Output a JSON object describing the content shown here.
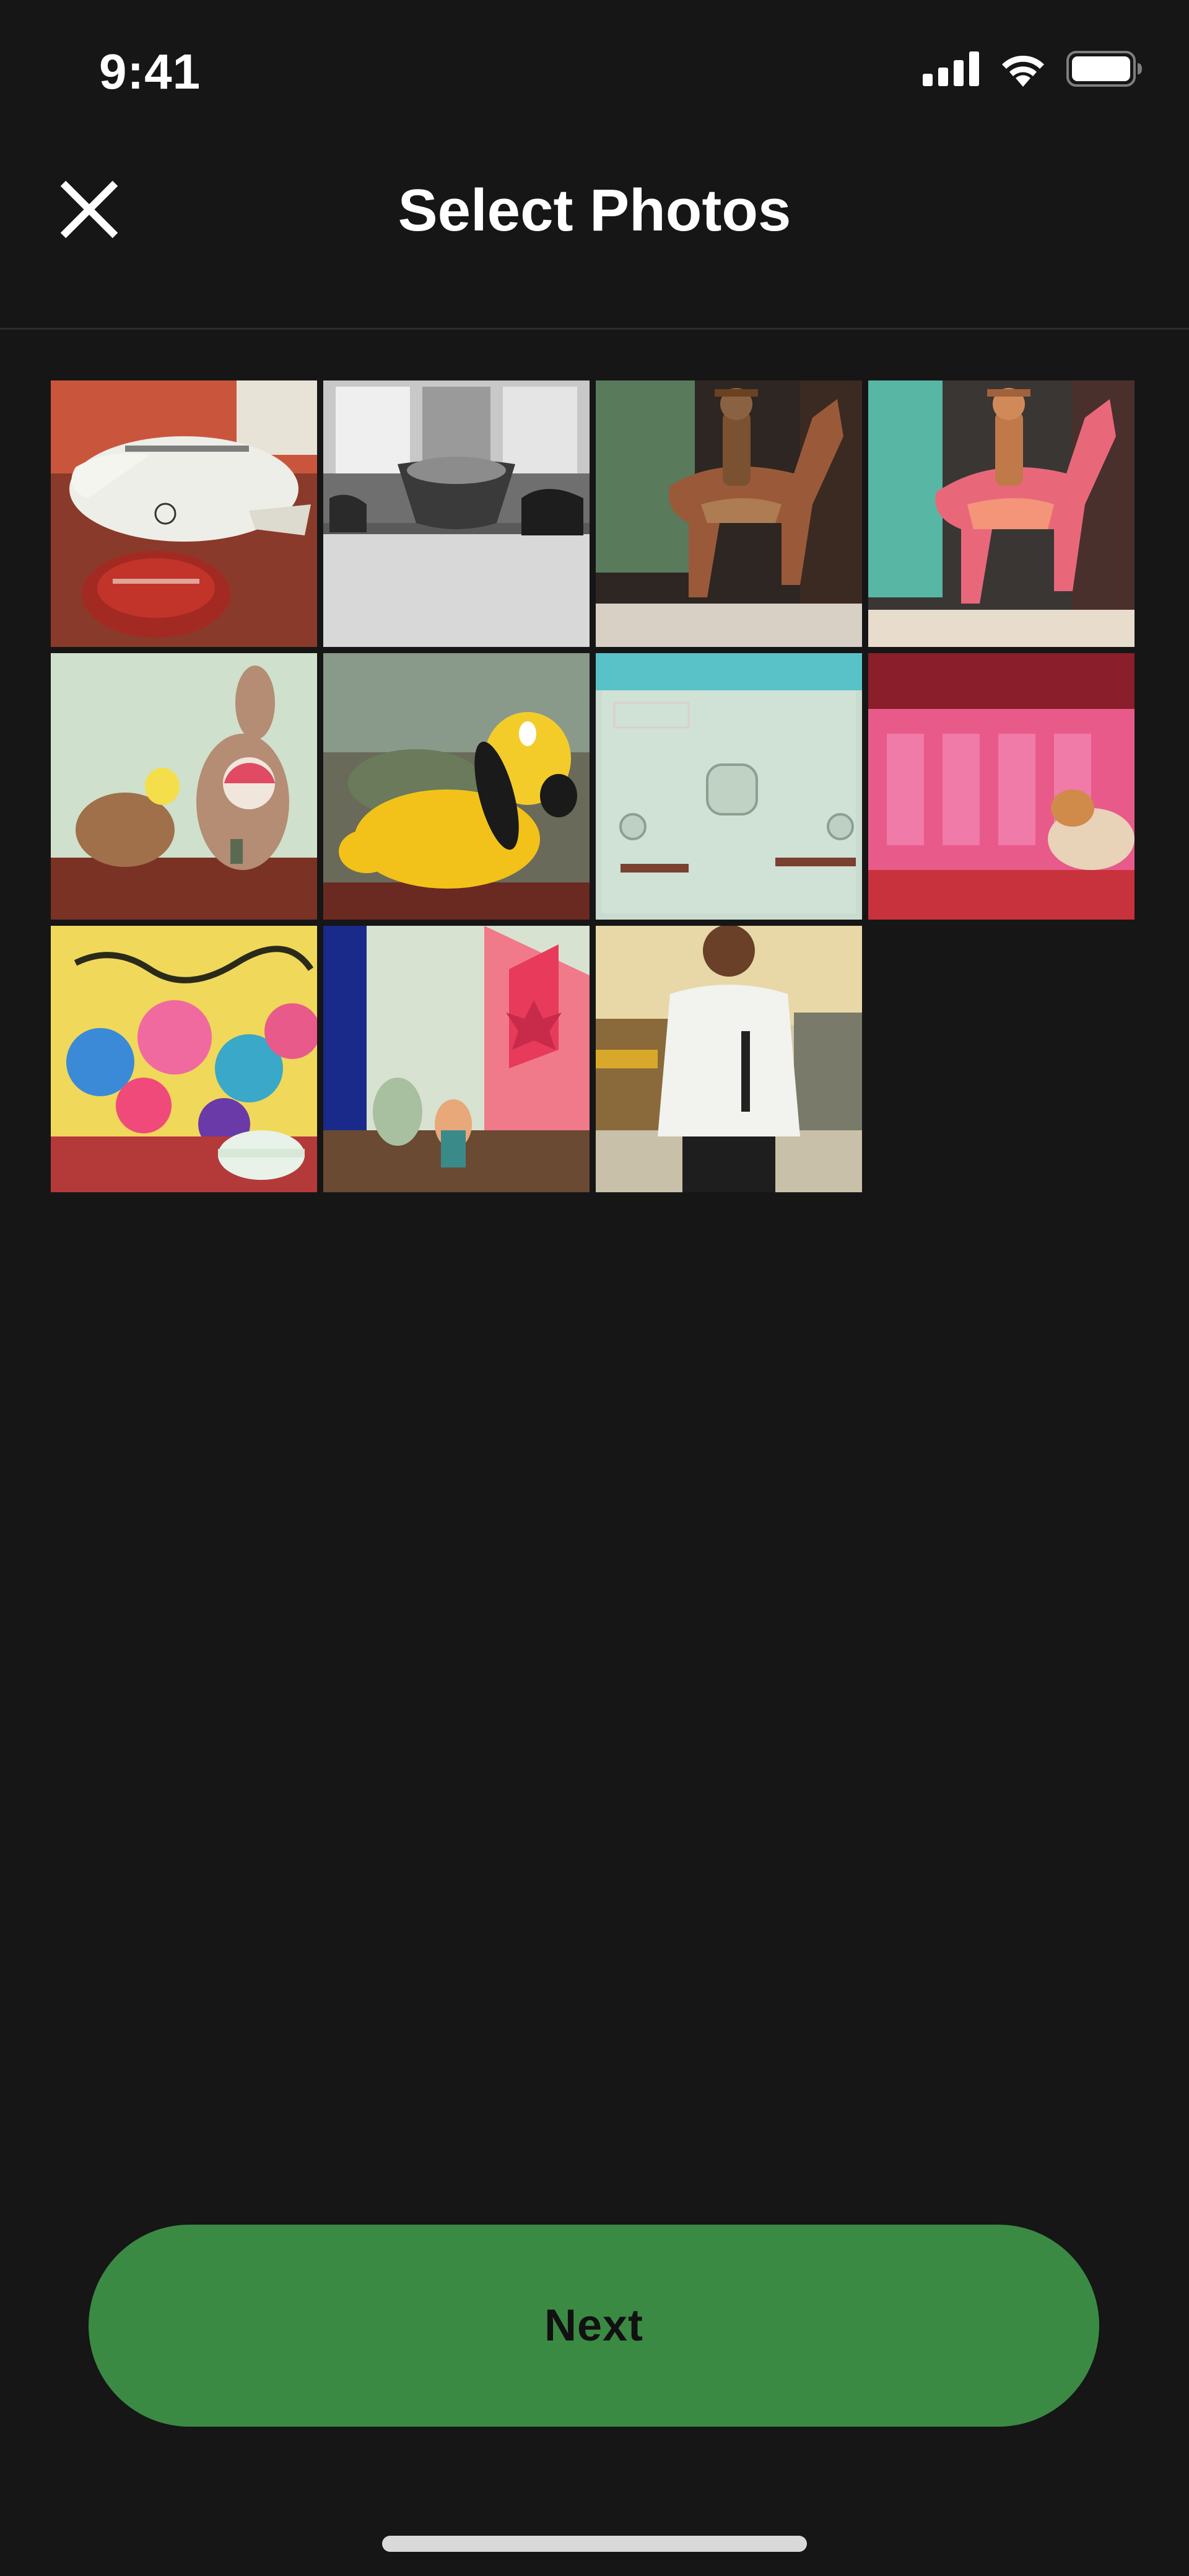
{
  "status_bar": {
    "time": "9:41",
    "icons": [
      "cellular-signal-icon",
      "wifi-icon",
      "battery-icon"
    ]
  },
  "header": {
    "title": "Select Photos",
    "close_icon": "close-icon"
  },
  "photos": [
    {
      "subject": "toy airplane with heart-shaped chocolate box"
    },
    {
      "subject": "black and white bowl on windowsill"
    },
    {
      "subject": "cowboy figure riding horse figurine"
    },
    {
      "subject": "cowboy figure riding horse figurine, colorized"
    },
    {
      "subject": "plush toys: bird and kangaroo"
    },
    {
      "subject": "yellow plush dog toy"
    },
    {
      "subject": "light switch on wall"
    },
    {
      "subject": "pink sign with stuffed animal"
    },
    {
      "subject": "flower painting with toy plane"
    },
    {
      "subject": "flags and figurines on shelf"
    },
    {
      "subject": "person standing on street"
    }
  ],
  "footer": {
    "next_label": "Next"
  },
  "colors": {
    "background": "#161616",
    "accent": "#3b8a44",
    "title_text": "#ffffff",
    "button_text": "#111111"
  }
}
